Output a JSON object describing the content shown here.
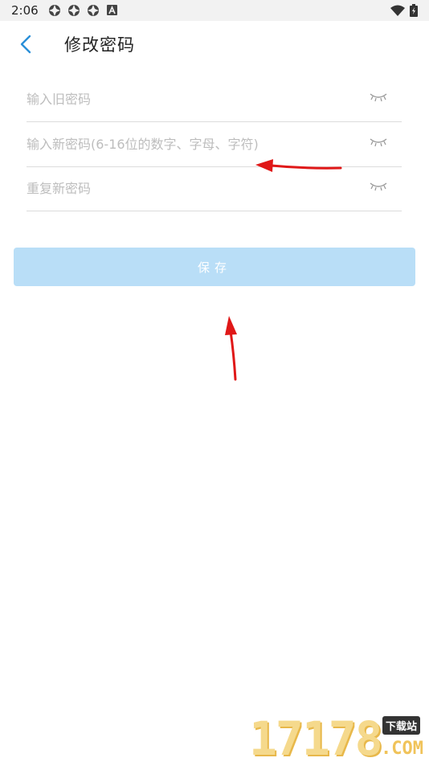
{
  "status_bar": {
    "time": "2:06",
    "icons": [
      "settings-icon",
      "settings-icon",
      "settings-icon",
      "text-a-icon"
    ],
    "right_icons": [
      "wifi-icon",
      "battery-charging-icon"
    ]
  },
  "header": {
    "back_icon": "chevron-left-icon",
    "title": "修改密码"
  },
  "form": {
    "old_password": {
      "placeholder": "输入旧密码",
      "value": ""
    },
    "new_password": {
      "placeholder": "输入新密码(6-16位的数字、字母、字符)",
      "value": ""
    },
    "repeat_password": {
      "placeholder": "重复新密码",
      "value": ""
    },
    "eye_icon": "eye-closed-icon"
  },
  "save_label": "保存",
  "colors": {
    "accent": "#2a8fd8",
    "save_bg": "#b9def7",
    "annotation": "#e01818"
  },
  "watermark": {
    "number": "17178",
    "badge": "下载站",
    "suffix": ".COM"
  }
}
